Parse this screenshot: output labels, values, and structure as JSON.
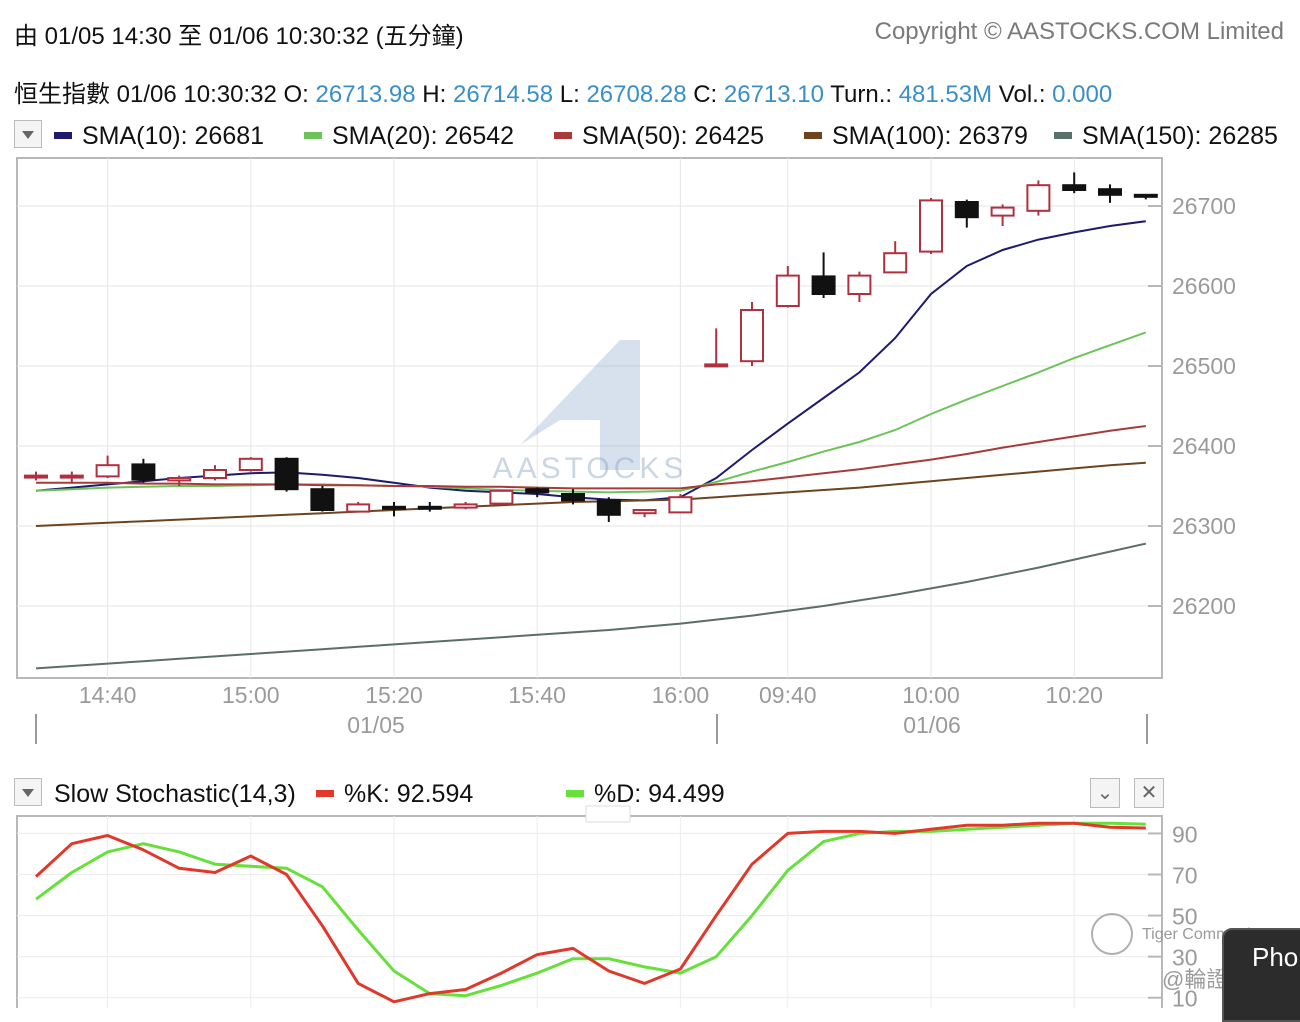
{
  "header": {
    "period": "由  01/05 14:30 至  01/06 10:30:32 (五分鐘)",
    "copyright": "Copyright © AASTOCKS.COM Limited"
  },
  "quote": {
    "name": "恒生指數",
    "time": "01/06 10:30:32",
    "o_label": "O:",
    "o": "26713.98",
    "h_label": "H:",
    "h": "26714.58",
    "l_label": "L:",
    "l": "26708.28",
    "c_label": "C:",
    "c": "26713.10",
    "turn_label": "Turn.:",
    "turn": "481.53M",
    "vol_label": "Vol.:",
    "vol": "0.000"
  },
  "sma_legend": [
    {
      "label": "SMA(10): 26681",
      "color": "#1f1a6e"
    },
    {
      "label": "SMA(20): 26542",
      "color": "#6cc35a"
    },
    {
      "label": "SMA(50): 26425",
      "color": "#a83a3a"
    },
    {
      "label": "SMA(100): 26379",
      "color": "#6e4420"
    },
    {
      "label": "SMA(150): 26285",
      "color": "#5a6e6a"
    }
  ],
  "stoch_legend": {
    "title": "Slow Stochastic(14,3)",
    "k_label": "%K: 92.594",
    "d_label": "%D: 94.499",
    "k_color": "#e0392b",
    "d_color": "#66e03a"
  },
  "watermark": "AASTOCKS",
  "overlay": {
    "community": "Tiger Community",
    "author": "@輪證贏家",
    "tab": "Pho"
  },
  "chart_data": [
    {
      "type": "candlestick",
      "title": "恒生指數",
      "ylim": [
        26110,
        26760
      ],
      "y_ticks": [
        26200,
        26300,
        26400,
        26500,
        26600,
        26700
      ],
      "x_ticks": [
        "14:40",
        "15:00",
        "15:20",
        "15:40",
        "16:00",
        "09:40",
        "10:00",
        "10:20"
      ],
      "date_labels": [
        "01/05",
        "01/06"
      ],
      "candles": [
        {
          "t": "14:30",
          "o": 26363,
          "h": 26368,
          "l": 26357,
          "c": 26363
        },
        {
          "t": "14:35",
          "o": 26362,
          "h": 26368,
          "l": 26354,
          "c": 26363
        },
        {
          "t": "14:40",
          "o": 26362,
          "h": 26388,
          "l": 26360,
          "c": 26376
        },
        {
          "t": "14:45",
          "o": 26377,
          "h": 26384,
          "l": 26354,
          "c": 26358
        },
        {
          "t": "14:50",
          "o": 26357,
          "h": 26363,
          "l": 26350,
          "c": 26360
        },
        {
          "t": "14:55",
          "o": 26360,
          "h": 26376,
          "l": 26357,
          "c": 26370
        },
        {
          "t": "15:00",
          "o": 26370,
          "h": 26386,
          "l": 26368,
          "c": 26384
        },
        {
          "t": "15:05",
          "o": 26384,
          "h": 26386,
          "l": 26343,
          "c": 26346
        },
        {
          "t": "15:10",
          "o": 26346,
          "h": 26350,
          "l": 26318,
          "c": 26320
        },
        {
          "t": "15:15",
          "o": 26318,
          "h": 26330,
          "l": 26317,
          "c": 26327
        },
        {
          "t": "15:20",
          "o": 26324,
          "h": 26330,
          "l": 26312,
          "c": 26322
        },
        {
          "t": "15:25",
          "o": 26324,
          "h": 26330,
          "l": 26318,
          "c": 26322
        },
        {
          "t": "15:30",
          "o": 26323,
          "h": 26330,
          "l": 26321,
          "c": 26327
        },
        {
          "t": "15:35",
          "o": 26328,
          "h": 26345,
          "l": 26326,
          "c": 26344
        },
        {
          "t": "15:40",
          "o": 26346,
          "h": 26348,
          "l": 26336,
          "c": 26342
        },
        {
          "t": "15:45",
          "o": 26340,
          "h": 26346,
          "l": 26327,
          "c": 26332
        },
        {
          "t": "15:50",
          "o": 26332,
          "h": 26336,
          "l": 26305,
          "c": 26314
        },
        {
          "t": "15:55",
          "o": 26316,
          "h": 26321,
          "l": 26311,
          "c": 26320
        },
        {
          "t": "16:00",
          "o": 26317,
          "h": 26340,
          "l": 26316,
          "c": 26336
        },
        {
          "t": "09:30",
          "o": 26501,
          "h": 26547,
          "l": 26501,
          "c": 26502
        },
        {
          "t": "09:35",
          "o": 26506,
          "h": 26580,
          "l": 26500,
          "c": 26570
        },
        {
          "t": "09:40",
          "o": 26575,
          "h": 26625,
          "l": 26573,
          "c": 26613
        },
        {
          "t": "09:45",
          "o": 26612,
          "h": 26642,
          "l": 26585,
          "c": 26590
        },
        {
          "t": "09:50",
          "o": 26590,
          "h": 26618,
          "l": 26580,
          "c": 26613
        },
        {
          "t": "09:55",
          "o": 26617,
          "h": 26656,
          "l": 26616,
          "c": 26641
        },
        {
          "t": "10:00",
          "o": 26643,
          "h": 26710,
          "l": 26640,
          "c": 26707
        },
        {
          "t": "10:05",
          "o": 26705,
          "h": 26708,
          "l": 26673,
          "c": 26686
        },
        {
          "t": "10:10",
          "o": 26688,
          "h": 26702,
          "l": 26675,
          "c": 26698
        },
        {
          "t": "10:15",
          "o": 26694,
          "h": 26732,
          "l": 26688,
          "c": 26726
        },
        {
          "t": "10:20",
          "o": 26726,
          "h": 26742,
          "l": 26716,
          "c": 26720
        },
        {
          "t": "10:25",
          "o": 26721,
          "h": 26727,
          "l": 26704,
          "c": 26714
        },
        {
          "t": "10:30",
          "o": 26713.98,
          "h": 26714.58,
          "l": 26708.28,
          "c": 26713.1
        }
      ],
      "series": [
        {
          "name": "SMA(10)",
          "color": "#1f1a6e",
          "values": [
            26344,
            26348,
            26352,
            26356,
            26360,
            26363,
            26366,
            26367,
            26364,
            26360,
            26354,
            26348,
            26344,
            26342,
            26340,
            26336,
            26333,
            26332,
            26336,
            26360,
            26395,
            26428,
            26460,
            26492,
            26535,
            26590,
            26625,
            26645,
            26658,
            26667,
            26675,
            26681
          ]
        },
        {
          "name": "SMA(20)",
          "color": "#6cc35a",
          "values": [
            26344,
            26346,
            26348,
            26349,
            26350,
            26350,
            26351,
            26352,
            26352,
            26351,
            26350,
            26349,
            26347,
            26345,
            26344,
            26343,
            26342,
            26343,
            26344,
            26355,
            26368,
            26380,
            26393,
            26405,
            26420,
            26440,
            26458,
            26475,
            26492,
            26510,
            26526,
            26542
          ]
        },
        {
          "name": "SMA(50)",
          "color": "#a83a3a",
          "values": [
            26354,
            26354,
            26354,
            26353,
            26353,
            26352,
            26352,
            26352,
            26351,
            26351,
            26350,
            26350,
            26349,
            26349,
            26348,
            26347,
            26347,
            26347,
            26347,
            26352,
            26356,
            26361,
            26366,
            26371,
            26377,
            26383,
            26390,
            26398,
            26405,
            26412,
            26419,
            26425
          ]
        },
        {
          "name": "SMA(100)",
          "color": "#6e4420",
          "values": [
            26300,
            26302,
            26304,
            26306,
            26308,
            26310,
            26312,
            26314,
            26316,
            26318,
            26320,
            26322,
            26324,
            26326,
            26328,
            26330,
            26331,
            26332,
            26333,
            26336,
            26339,
            26342,
            26345,
            26348,
            26352,
            26356,
            26360,
            26364,
            26368,
            26372,
            26376,
            26379
          ]
        },
        {
          "name": "SMA(150)",
          "color": "#5a6e6a",
          "values": [
            26122,
            26125,
            26128,
            26131,
            26134,
            26137,
            26140,
            26143,
            26146,
            26149,
            26152,
            26155,
            26158,
            26161,
            26164,
            26167,
            26170,
            26174,
            26178,
            26183,
            26188,
            26194,
            26200,
            26207,
            26214,
            26222,
            26230,
            26239,
            26248,
            26258,
            26268,
            26278
          ]
        }
      ]
    },
    {
      "type": "line",
      "title": "Slow Stochastic(14,3)",
      "ylim": [
        5,
        98
      ],
      "y_ticks": [
        10,
        30,
        50,
        70,
        90
      ],
      "series": [
        {
          "name": "%K",
          "color": "#e0392b",
          "values": [
            69,
            85,
            89,
            82,
            73,
            71,
            79,
            70,
            45,
            17,
            8,
            12,
            14,
            22,
            31,
            34,
            23,
            17,
            24,
            50,
            75,
            90,
            91,
            91,
            90,
            92,
            94,
            94,
            95,
            95,
            93,
            92.594
          ]
        },
        {
          "name": "%D",
          "color": "#66e03a",
          "values": [
            58,
            71,
            81,
            85,
            81,
            75,
            74,
            73,
            64,
            43,
            23,
            12,
            11,
            16,
            22,
            29,
            29,
            25,
            22,
            30,
            50,
            72,
            86,
            90,
            91,
            91,
            92,
            93,
            94,
            95,
            95,
            94.499
          ]
        }
      ]
    }
  ]
}
